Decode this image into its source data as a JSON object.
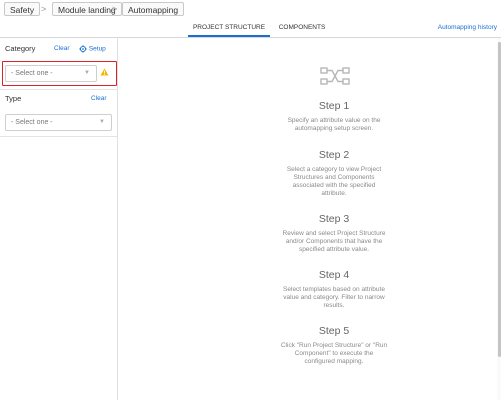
{
  "breadcrumb": {
    "items": [
      "Safety",
      "Module landing",
      "Automapping"
    ],
    "separator": ">"
  },
  "tabs": {
    "items": [
      "PROJECT STRUCTURE",
      "COMPONENTS"
    ],
    "active": "PROJECT STRUCTURE",
    "history_link": "Automapping history"
  },
  "left_panel": {
    "category": {
      "label": "Category",
      "clear": "Clear",
      "setup": "Setup",
      "placeholder": "- Select one -",
      "warning": true
    },
    "type": {
      "label": "Type",
      "clear": "Clear",
      "placeholder": "- Select one -"
    }
  },
  "steps": [
    {
      "title": "Step 1",
      "lines": [
        "Specify an attribute value on the",
        "automapping setup screen."
      ]
    },
    {
      "title": "Step 2",
      "lines": [
        "Select a category to view Project",
        "Structures and Components",
        "associated with the specified",
        "attribute."
      ]
    },
    {
      "title": "Step 3",
      "lines": [
        "Review and select Project Structure",
        "and/or Components that have the",
        "specified attribute value."
      ]
    },
    {
      "title": "Step 4",
      "lines": [
        "Select templates based on attribute",
        "value and category. Filter to narrow",
        "results."
      ]
    },
    {
      "title": "Step 5",
      "lines": [
        "Click \"Run Project Structure\" or \"Run",
        "Component\" to execute the",
        "configured mapping."
      ]
    }
  ],
  "colors": {
    "accent": "#1a6fd4",
    "highlight": "#d9232a",
    "warning": "#f2b705"
  },
  "icons": {
    "hero": "automapping-flow-icon",
    "warning": "warning-triangle-icon",
    "setup": "gear-icon"
  }
}
